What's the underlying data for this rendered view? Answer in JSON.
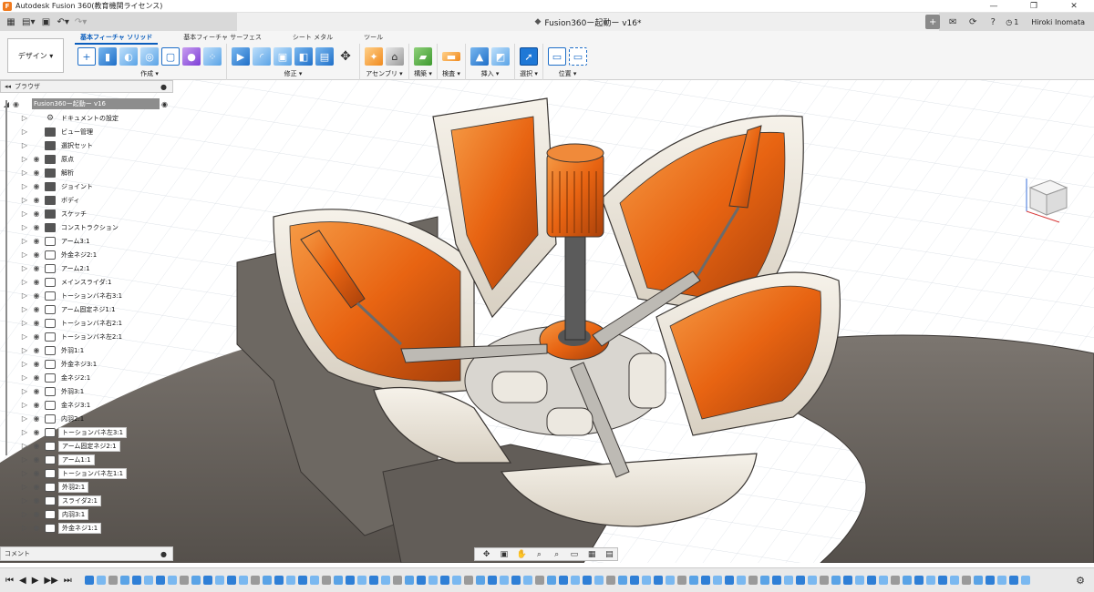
{
  "window": {
    "title": "Autodesk Fusion 360(教育機関ライセンス)",
    "minimize": "—",
    "maximize": "❐",
    "close": "✕"
  },
  "tabbar": {
    "document_title": "Fusion360ー起動ー v16*",
    "user": "Hiroki Inomata",
    "notifications": "1"
  },
  "toolbar": {
    "workspace": "デザイン ▾",
    "tabs": [
      "基本フィーチャ ソリッド",
      "基本フィーチャ サーフェス",
      "シート メタル",
      "ツール"
    ],
    "groups": [
      {
        "label": "作成 ▾"
      },
      {
        "label": "修正 ▾"
      },
      {
        "label": "アセンブリ ▾"
      },
      {
        "label": "構築 ▾"
      },
      {
        "label": "検査 ▾"
      },
      {
        "label": "挿入 ▾"
      },
      {
        "label": "選択 ▾"
      },
      {
        "label": "位置 ▾"
      }
    ]
  },
  "browser": {
    "title": "ブラウザ",
    "root": "Fusion360ー起動ー v16",
    "items": [
      {
        "label": "ドキュメントの設定",
        "icon": "gear",
        "eye": false
      },
      {
        "label": "ビュー管理",
        "icon": "folder",
        "eye": false
      },
      {
        "label": "選択セット",
        "icon": "folder",
        "eye": false
      },
      {
        "label": "原点",
        "icon": "folder",
        "eye": true
      },
      {
        "label": "解析",
        "icon": "folder",
        "eye": true
      },
      {
        "label": "ジョイント",
        "icon": "folder",
        "eye": true
      },
      {
        "label": "ボディ",
        "icon": "folder",
        "eye": true
      },
      {
        "label": "スケッチ",
        "icon": "folder",
        "eye": true
      },
      {
        "label": "コンストラクション",
        "icon": "folder",
        "eye": true
      },
      {
        "label": "アーム3:1",
        "icon": "comp",
        "eye": true
      },
      {
        "label": "外金ネジ2:1",
        "icon": "comp",
        "eye": true
      },
      {
        "label": "アーム2:1",
        "icon": "comp",
        "eye": true
      },
      {
        "label": "メインスライダ:1",
        "icon": "comp",
        "eye": true
      },
      {
        "label": "トーションバネ右3:1",
        "icon": "comp",
        "eye": true
      },
      {
        "label": "アーム固定ネジ1:1",
        "icon": "comp",
        "eye": true
      },
      {
        "label": "トーションバネ右2:1",
        "icon": "comp",
        "eye": true
      },
      {
        "label": "トーションバネ左2:1",
        "icon": "comp",
        "eye": true
      },
      {
        "label": "外羽1:1",
        "icon": "comp",
        "eye": true
      },
      {
        "label": "外金ネジ3:1",
        "icon": "comp",
        "eye": true
      },
      {
        "label": "金ネジ2:1",
        "icon": "comp",
        "eye": true
      },
      {
        "label": "外羽3:1",
        "icon": "comp",
        "eye": true
      },
      {
        "label": "金ネジ3:1",
        "icon": "comp",
        "eye": true
      },
      {
        "label": "内羽2:1",
        "icon": "comp",
        "eye": true
      },
      {
        "label": "トーションバネ左3:1",
        "icon": "comp",
        "eye": true,
        "boxed": true
      },
      {
        "label": "アーム固定ネジ2:1",
        "icon": "comp",
        "eye": true,
        "boxed": true
      },
      {
        "label": "アーム1:1",
        "icon": "comp",
        "eye": true,
        "boxed": true
      },
      {
        "label": "トーションバネ左1:1",
        "icon": "comp",
        "eye": true,
        "boxed": true
      },
      {
        "label": "外羽2:1",
        "icon": "comp",
        "eye": true,
        "boxed": true
      },
      {
        "label": "スライダ2:1",
        "icon": "comp",
        "eye": true,
        "boxed": true
      },
      {
        "label": "内羽3:1",
        "icon": "comp",
        "eye": true,
        "boxed": true
      },
      {
        "label": "外金ネジ1:1",
        "icon": "comp",
        "eye": true,
        "boxed": true
      }
    ]
  },
  "comments": {
    "title": "コメント"
  },
  "colors": {
    "accent": "#0b5ebd",
    "orange": "#e86412",
    "shell": "#ece6dc",
    "base": "#6f6a64"
  }
}
